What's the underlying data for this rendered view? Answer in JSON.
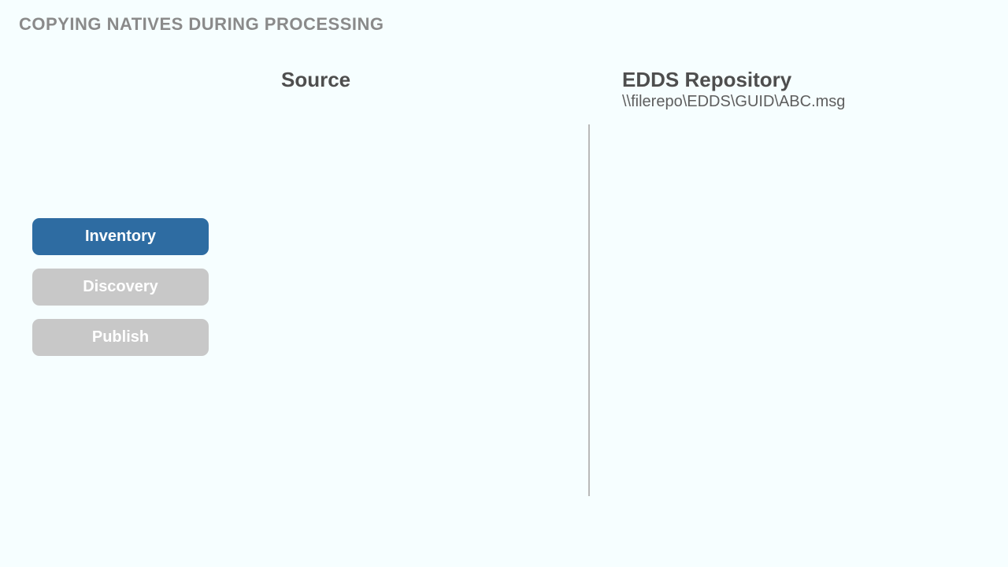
{
  "title": "COPYING NATIVES DURING PROCESSING",
  "columns": {
    "source_label": "Source",
    "repo_label": "EDDS Repository",
    "repo_path": "\\\\filerepo\\EDDS\\GUID\\ABC.msg"
  },
  "stages": {
    "inventory": "Inventory",
    "discovery": "Discovery",
    "publish": "Publish"
  }
}
